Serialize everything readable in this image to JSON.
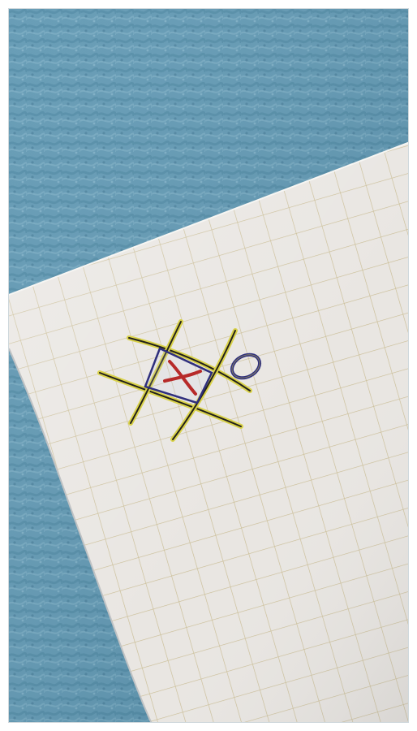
{
  "scene": {
    "background": "blue-fleece-fabric",
    "object": "grid-paper-sheet",
    "drawing": "tic-tac-toe-board"
  },
  "colors": {
    "fabric": "#5f97b2",
    "fabric_shadow": "#3f7792",
    "fabric_light": "#86b6cc",
    "paper": "#e9e6e2",
    "paper_shade": "#d8d7d6",
    "grid_line": "#c9bc93",
    "pencil_yellow": "#d9d24a",
    "pencil_dark": "#23211b",
    "ink_blue": "#2f2f7d",
    "ink_red": "#b72a2a"
  },
  "board": {
    "cells_marked": [
      {
        "cell": "center",
        "mark": "X",
        "color": "red"
      },
      {
        "cell": "outside-right-top",
        "mark": "O",
        "color": "blue"
      }
    ],
    "highlighted_cell": "center"
  }
}
